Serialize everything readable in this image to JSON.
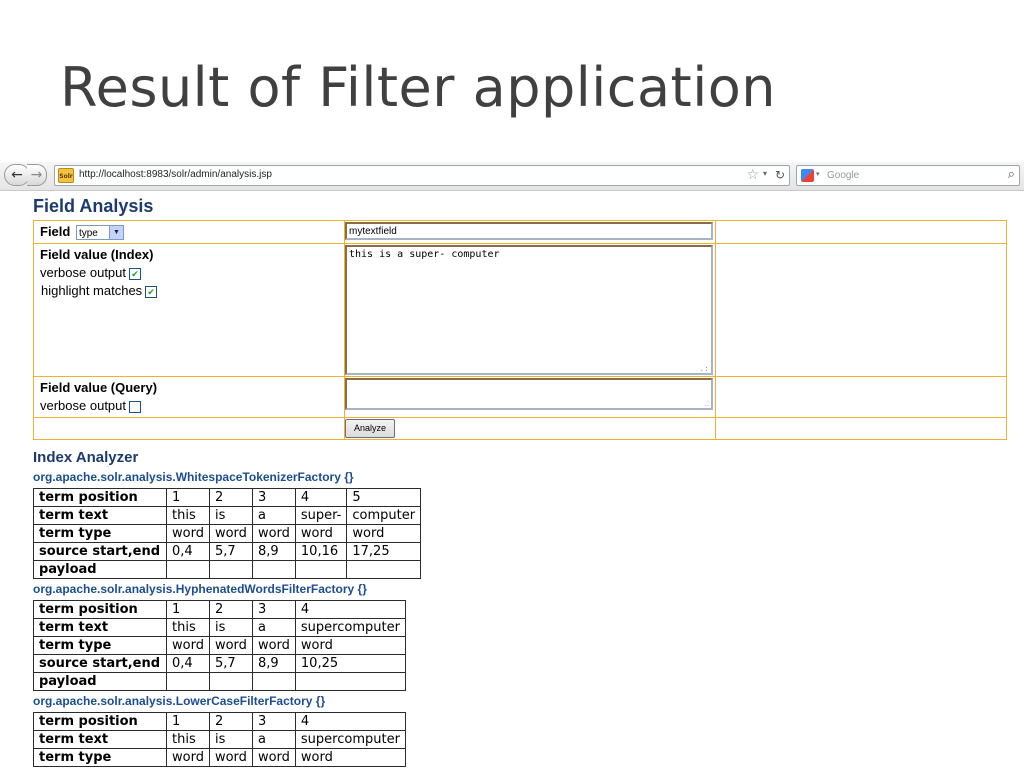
{
  "slide": {
    "title": "Result of Filter application"
  },
  "browser": {
    "url": "http://localhost:8983/solr/admin/analysis.jsp",
    "favicon_text": "Solr",
    "search_placeholder": "Google"
  },
  "page": {
    "heading": "Field Analysis",
    "field_label": "Field",
    "field_type_selected": "type",
    "field_name_value": "mytextfield",
    "index_value_label": "Field value (Index)",
    "verbose_output_label": "verbose output",
    "highlight_matches_label": "highlight matches",
    "index_text": "this is a super- computer",
    "query_value_label": "Field value (Query)",
    "query_verbose_label": "verbose output",
    "analyze_button": "Analyze",
    "index_verbose_checked": true,
    "highlight_checked": true,
    "query_verbose_checked": false
  },
  "analyzer": {
    "title": "Index Analyzer",
    "row_headers": [
      "term position",
      "term text",
      "term type",
      "source start,end",
      "payload"
    ],
    "stages": [
      {
        "factory": "org.apache.solr.analysis.WhitespaceTokenizerFactory {}",
        "rows": [
          [
            "1",
            "2",
            "3",
            "4",
            "5"
          ],
          [
            "this",
            "is",
            "a",
            "super-",
            "computer"
          ],
          [
            "word",
            "word",
            "word",
            "word",
            "word"
          ],
          [
            "0,4",
            "5,7",
            "8,9",
            "10,16",
            "17,25"
          ],
          [
            "",
            "",
            "",
            "",
            ""
          ]
        ]
      },
      {
        "factory": "org.apache.solr.analysis.HyphenatedWordsFilterFactory {}",
        "rows": [
          [
            "1",
            "2",
            "3",
            "4"
          ],
          [
            "this",
            "is",
            "a",
            "supercomputer"
          ],
          [
            "word",
            "word",
            "word",
            "word"
          ],
          [
            "0,4",
            "5,7",
            "8,9",
            "10,25"
          ],
          [
            "",
            "",
            "",
            ""
          ]
        ]
      },
      {
        "factory": "org.apache.solr.analysis.LowerCaseFilterFactory {}",
        "rows": [
          [
            "1",
            "2",
            "3",
            "4"
          ],
          [
            "this",
            "is",
            "a",
            "supercomputer"
          ],
          [
            "word",
            "word",
            "word",
            "word"
          ]
        ]
      }
    ]
  }
}
